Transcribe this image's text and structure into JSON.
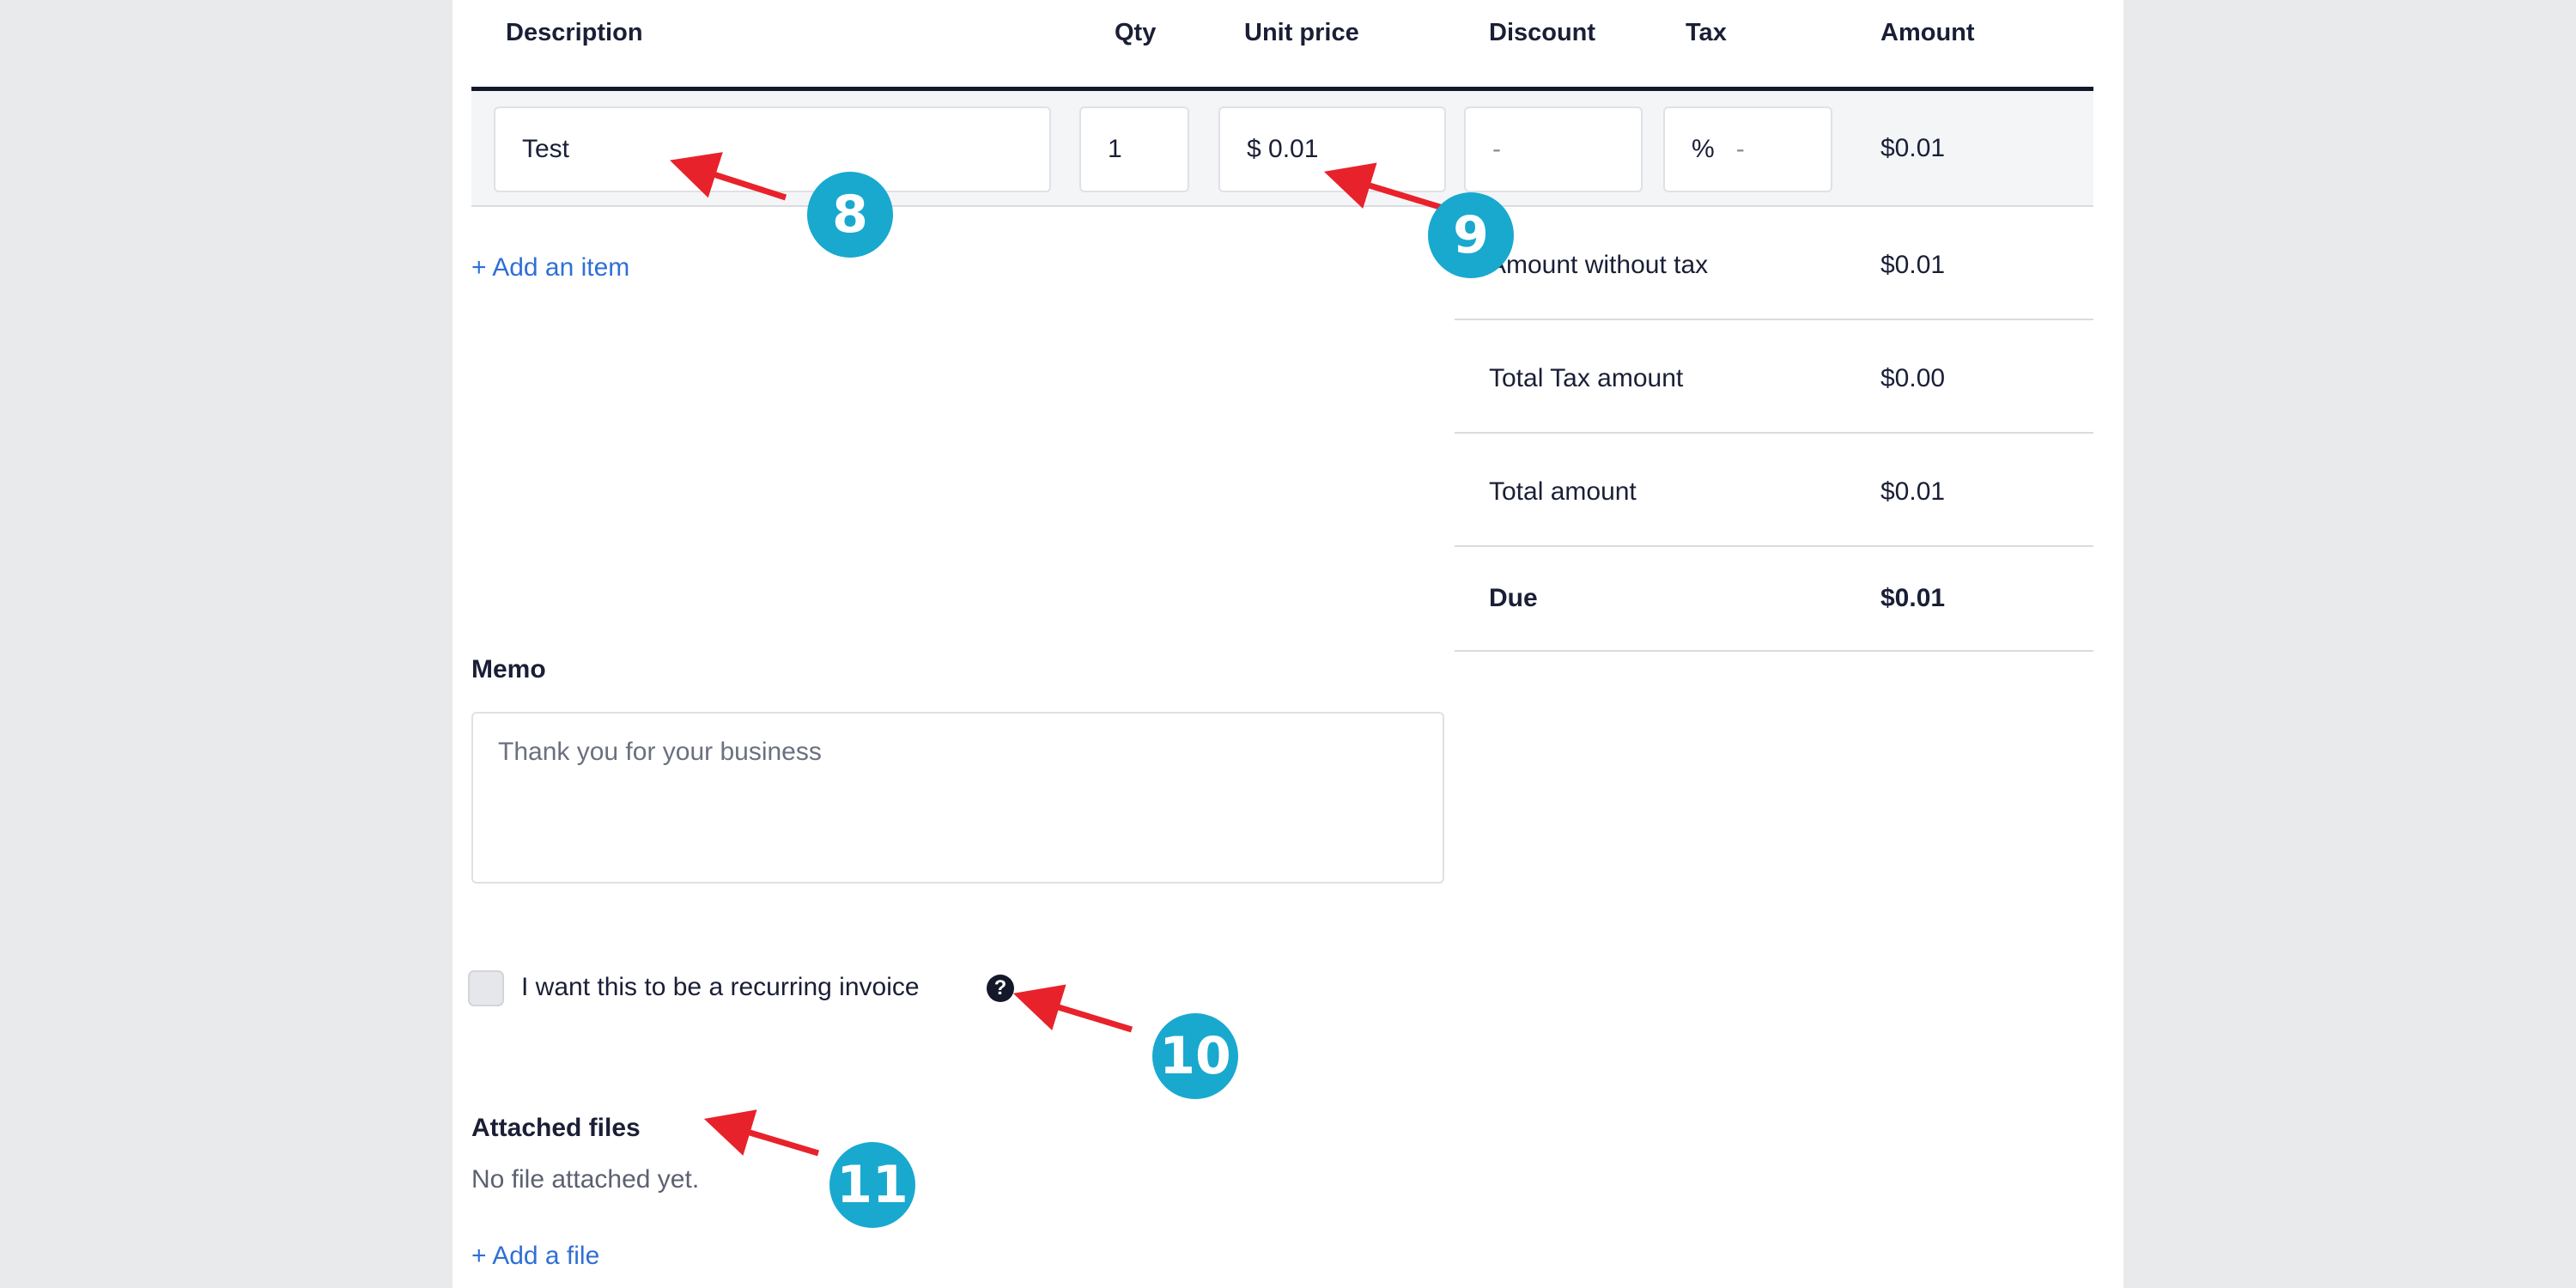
{
  "table": {
    "headers": {
      "description": "Description",
      "qty": "Qty",
      "unit_price": "Unit price",
      "discount": "Discount",
      "tax": "Tax",
      "amount": "Amount"
    },
    "rows": [
      {
        "description": "Test",
        "qty": "1",
        "unit_price_prefix": "$",
        "unit_price": "0.01",
        "discount": "-",
        "tax_prefix": "%",
        "tax": "-",
        "amount": "$0.01"
      }
    ],
    "add_item_label": "+ Add an item"
  },
  "totals": [
    {
      "label": "Amount without tax",
      "value": "$0.01"
    },
    {
      "label": "Total Tax amount",
      "value": "$0.00"
    },
    {
      "label": "Total amount",
      "value": "$0.01"
    },
    {
      "label": "Due",
      "value": "$0.01"
    }
  ],
  "memo": {
    "title": "Memo",
    "placeholder": "Thank you for your business"
  },
  "recurring": {
    "label": "I want this to be a recurring invoice",
    "help_icon": "?",
    "checked": false
  },
  "attachments": {
    "title": "Attached files",
    "empty_text": "No file attached yet.",
    "add_file_label": "+ Add a file"
  },
  "annotations": {
    "badges": [
      "8",
      "9",
      "10",
      "11"
    ],
    "badge_color": "#19a9cf",
    "arrow_color": "#e8222b"
  }
}
